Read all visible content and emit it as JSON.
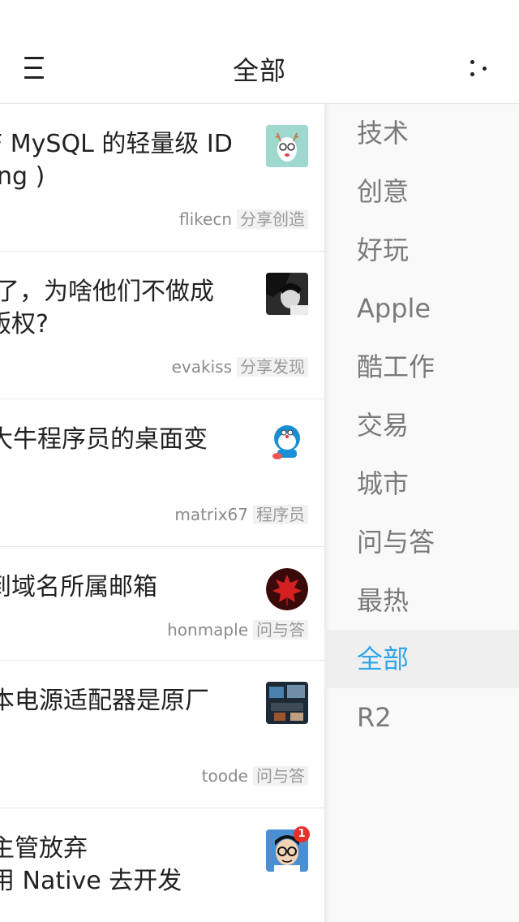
{
  "header": {
    "title": "全部",
    "menu_icon": "hamburger-menu-icon",
    "more_icon": "more-dots-icon"
  },
  "feed": {
    "items": [
      {
        "title_lines": [
          "F MySQL 的轻量级 ID",
          "ng )"
        ],
        "author": "flikecn",
        "node": "分享创造"
      },
      {
        "title_lines": [
          "了，为啥他们不做成",
          "版权?"
        ],
        "author": "evakiss",
        "node": "分享发现"
      },
      {
        "title_lines": [
          "大牛程序员的桌面变"
        ],
        "author": "matrix67",
        "node": "程序员"
      },
      {
        "title_lines": [
          "到域名所属邮箱"
        ],
        "author": "honmaple",
        "node": "问与答"
      },
      {
        "title_lines": [
          "本电源适配器是原厂"
        ],
        "author": "toode",
        "node": "问与答"
      },
      {
        "title_lines": [
          "主管放弃",
          "用 Native 去开发"
        ],
        "author": "",
        "node": "",
        "badge": "1"
      }
    ]
  },
  "sidebar": {
    "items": [
      {
        "label": "技术"
      },
      {
        "label": "创意"
      },
      {
        "label": "好玩"
      },
      {
        "label": "Apple"
      },
      {
        "label": "酷工作"
      },
      {
        "label": "交易"
      },
      {
        "label": "城市"
      },
      {
        "label": "问与答"
      },
      {
        "label": "最热"
      },
      {
        "label": "全部"
      },
      {
        "label": "R2"
      }
    ],
    "active_index": 9
  },
  "colors": {
    "accent": "#2fa4e7",
    "text_primary": "#222222",
    "text_muted": "#7a7a7a",
    "divider": "#e6e6e6",
    "panel_bg": "#f9f9f9"
  }
}
